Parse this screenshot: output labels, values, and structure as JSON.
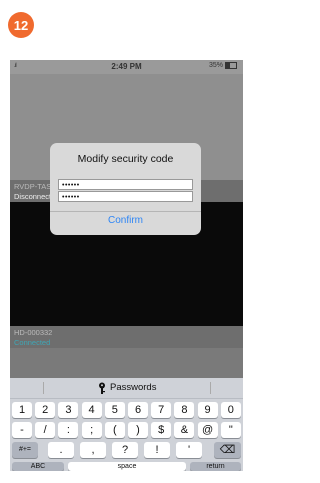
{
  "step_badge": "12",
  "status_bar": {
    "signal_label": ".ıl",
    "time": "2:49 PM",
    "battery": "35%"
  },
  "devices": [
    {
      "name": "RVDP-TAS-352",
      "state": "Disconnected"
    },
    {
      "name": "HD-000332",
      "state": "Connected"
    }
  ],
  "dialog": {
    "title": "Modify security code",
    "password1": "••••••",
    "password2": "••••••",
    "confirm_label": "Confirm"
  },
  "keyboard": {
    "suggestion_label": "Passwords",
    "row1": [
      "1",
      "2",
      "3",
      "4",
      "5",
      "6",
      "7",
      "8",
      "9",
      "0"
    ],
    "row2": [
      "-",
      "/",
      ":",
      ";",
      "(",
      ")",
      "$",
      "&",
      "@",
      "\""
    ],
    "row3_shift": "#+=",
    "row3": [
      ".",
      ",",
      "?",
      "!",
      "'"
    ],
    "backspace_glyph": "⌫",
    "abc_label": "ABC",
    "space_label": "space",
    "return_label": "return"
  },
  "colors": {
    "badge": "#f06a2e",
    "accent": "#2f86f5",
    "connected": "#3fa6b5"
  }
}
